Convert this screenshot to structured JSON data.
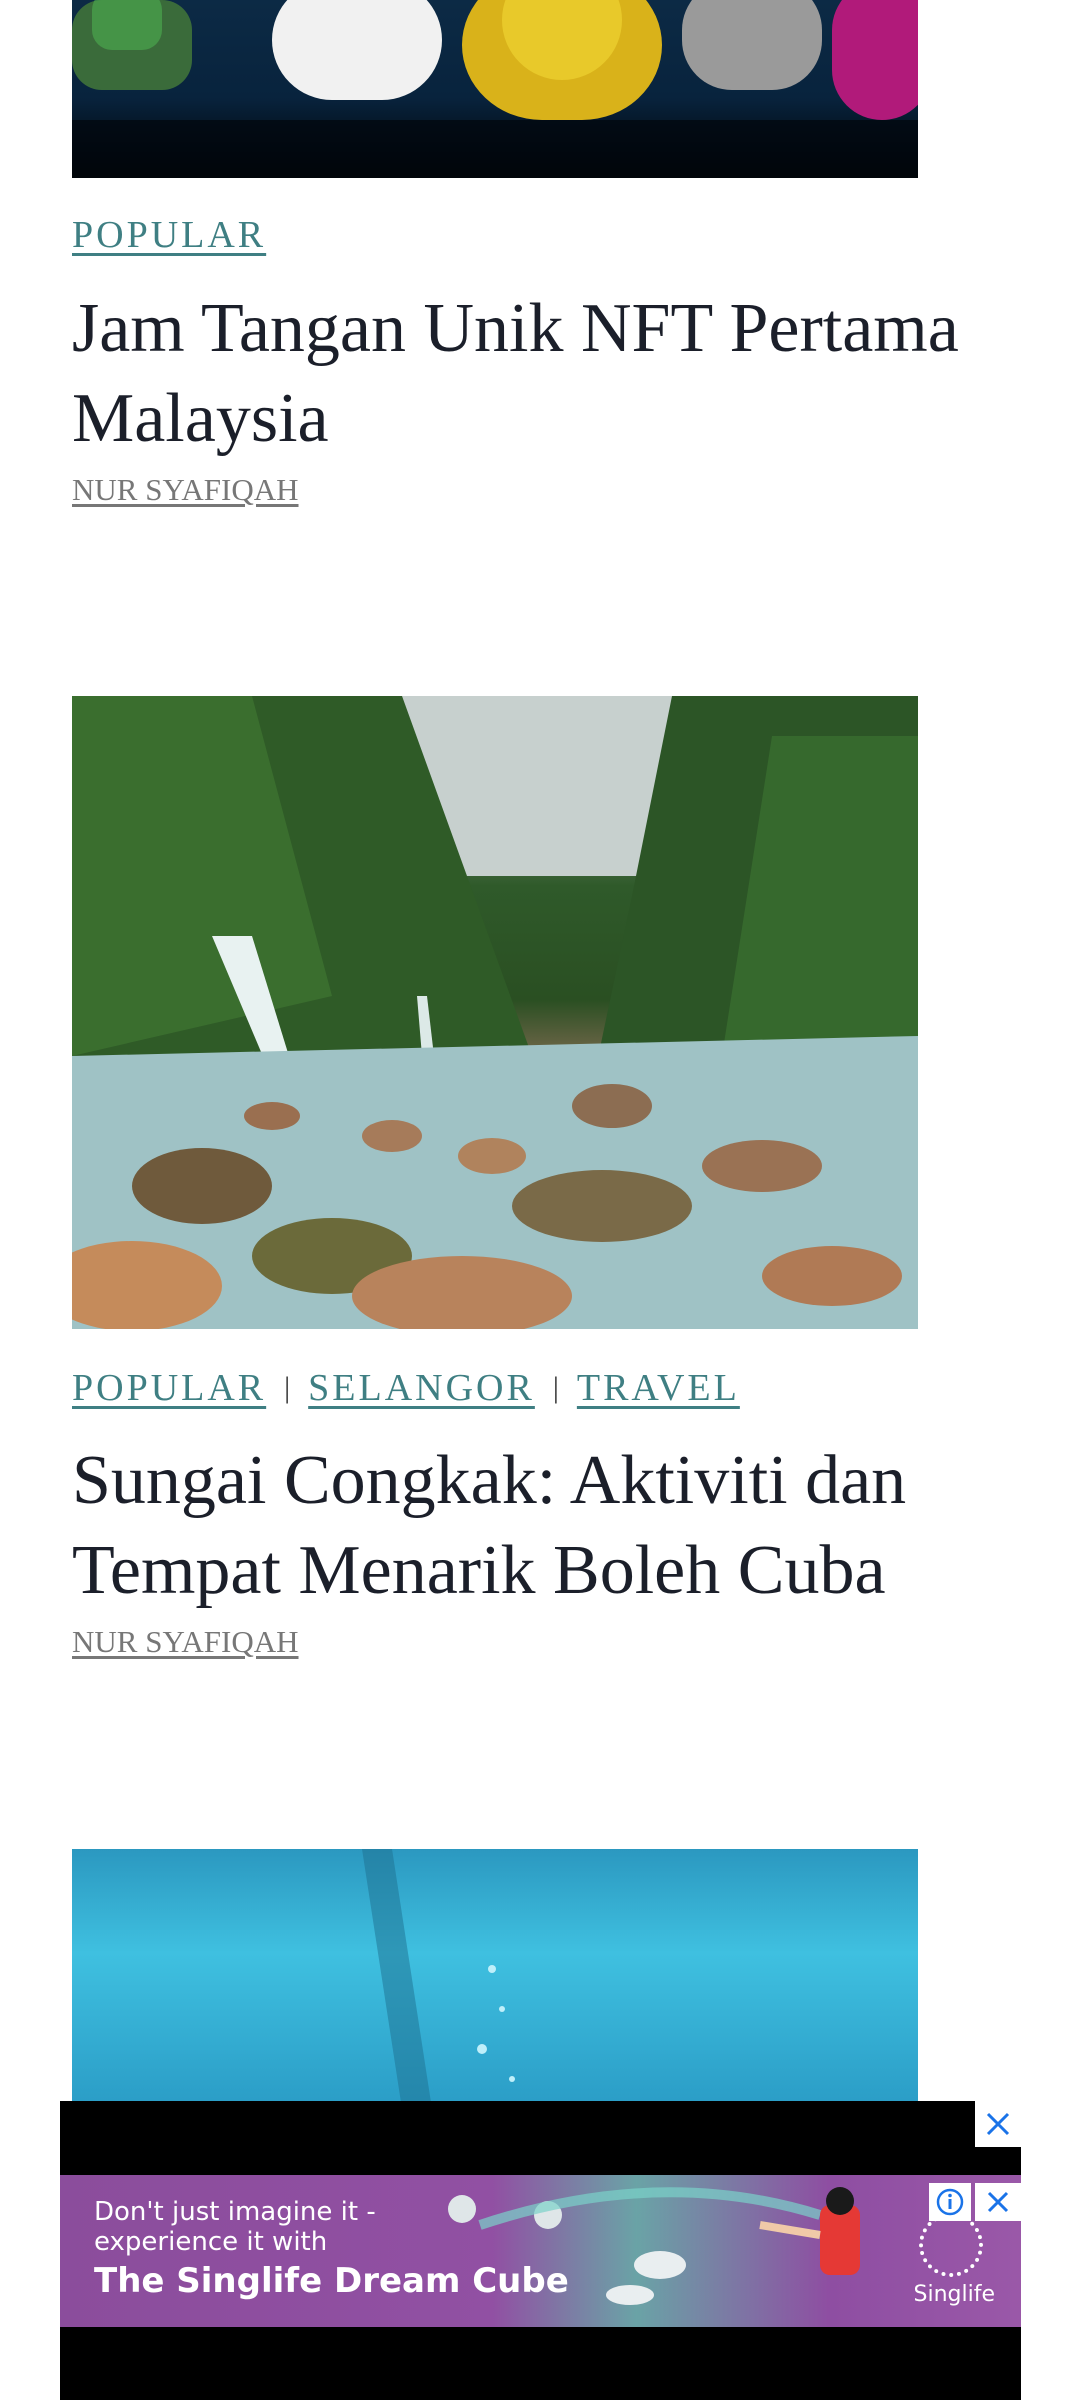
{
  "articles": [
    {
      "categories": [
        "POPULAR"
      ],
      "title": "Jam Tangan Unik NFT Pertama Malaysia",
      "author": "NUR SYAFIQAH"
    },
    {
      "categories": [
        "POPULAR",
        "SELANGOR",
        "TRAVEL"
      ],
      "separator": "|",
      "title": "Sungai Congkak: Aktiviti dan Tempat Menarik Boleh Cuba",
      "author": "NUR SYAFIQAH"
    }
  ],
  "ad": {
    "line1": "Don't just imagine it -",
    "line2": "experience it with",
    "headline": "The Singlife Dream Cube",
    "brand": "Singlife"
  },
  "colors": {
    "category": "#3f7f83",
    "title": "#1b1f2a",
    "author": "#777777",
    "ad_bg": "#8b4d9c",
    "ad_close": "#1a73e8"
  }
}
